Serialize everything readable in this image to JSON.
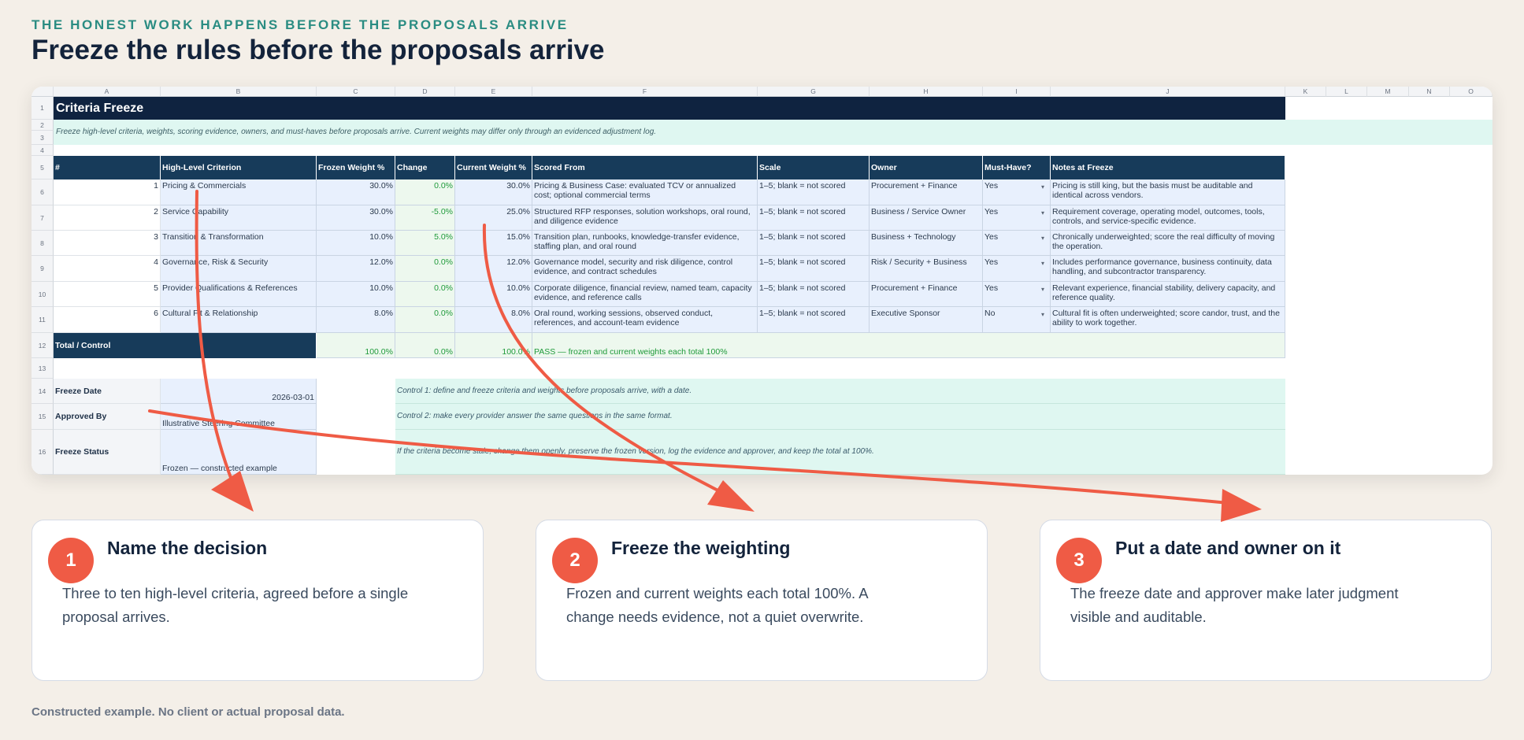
{
  "header": {
    "eyebrow": "THE HONEST WORK HAPPENS BEFORE THE PROPOSALS ARRIVE",
    "title": "Freeze the rules before the proposals arrive"
  },
  "sheet": {
    "columns": [
      "A",
      "B",
      "C",
      "D",
      "E",
      "F",
      "G",
      "H",
      "I",
      "J",
      "K",
      "L",
      "M",
      "N",
      "O"
    ],
    "rows": [
      "1",
      "2",
      "3",
      "4",
      "5",
      "6",
      "7",
      "8",
      "9",
      "10",
      "11",
      "12",
      "13",
      "14",
      "15",
      "16"
    ],
    "title": "Criteria Freeze",
    "intro": "Freeze high-level criteria, weights, scoring evidence, owners, and must-haves before proposals arrive. Current weights may differ only through an evidenced adjustment log.",
    "table_headers": [
      "#",
      "High-Level Criterion",
      "Frozen Weight %",
      "Change",
      "Current Weight %",
      "Scored From",
      "Scale",
      "Owner",
      "Must-Have?",
      "Notes at Freeze"
    ],
    "table_rows": [
      [
        "1",
        "Pricing & Commercials",
        "30.0%",
        "0.0%",
        "30.0%",
        "Pricing & Business Case: evaluated TCV or annualized cost; optional commercial terms",
        "1–5; blank = not scored",
        "Procurement + Finance",
        "Yes",
        "Pricing is still king, but the basis must be auditable and identical across vendors."
      ],
      [
        "2",
        "Service Capability",
        "30.0%",
        "-5.0%",
        "25.0%",
        "Structured RFP responses, solution workshops, oral round, and diligence evidence",
        "1–5; blank = not scored",
        "Business / Service Owner",
        "Yes",
        "Requirement coverage, operating model, outcomes, tools, controls, and service-specific evidence."
      ],
      [
        "3",
        "Transition & Transformation",
        "10.0%",
        "5.0%",
        "15.0%",
        "Transition plan, runbooks, knowledge-transfer evidence, staffing plan, and oral round",
        "1–5; blank = not scored",
        "Business + Technology",
        "Yes",
        "Chronically underweighted; score the real difficulty of moving the operation."
      ],
      [
        "4",
        "Governance, Risk & Security",
        "12.0%",
        "0.0%",
        "12.0%",
        "Governance model, security and risk diligence, control evidence, and contract schedules",
        "1–5; blank = not scored",
        "Risk / Security + Business",
        "Yes",
        "Includes performance governance, business continuity, data handling, and subcontractor transparency."
      ],
      [
        "5",
        "Provider Qualifications & References",
        "10.0%",
        "0.0%",
        "10.0%",
        "Corporate diligence, financial review, named team, capacity evidence, and reference calls",
        "1–5; blank = not scored",
        "Procurement + Finance",
        "Yes",
        "Relevant experience, financial stability, delivery capacity, and reference quality."
      ],
      [
        "6",
        "Cultural Fit & Relationship",
        "8.0%",
        "0.0%",
        "8.0%",
        "Oral round, working sessions, observed conduct, references, and account-team evidence",
        "1–5; blank = not scored",
        "Executive Sponsor",
        "No",
        "Cultural fit is often underweighted; score candor, trust, and the ability to work together."
      ]
    ],
    "total": {
      "label": "Total / Control",
      "frozen": "100.0%",
      "change": "0.0%",
      "current": "100.0%",
      "status": "PASS — frozen and current weights each total 100%"
    },
    "meta": [
      {
        "label": "Freeze Date",
        "value": "2026-03-01",
        "control": "Control 1: define and freeze criteria and weights before proposals arrive, with a date."
      },
      {
        "label": "Approved By",
        "value": "Illustrative Steering Committee",
        "control": "Control 2: make every provider answer the same questions in the same format."
      },
      {
        "label": "Freeze Status",
        "value": "Frozen — constructed example",
        "control": "If the criteria become stale, change them openly, preserve the frozen version, log the evidence and approver, and keep the total at 100%."
      }
    ],
    "dropdown_glyph": "▾"
  },
  "cards": [
    {
      "number": "1",
      "title": "Name the decision",
      "text": "Three to ten high-level criteria, agreed before a single proposal arrives."
    },
    {
      "number": "2",
      "title": "Freeze the weighting",
      "text": "Frozen and current weights each total 100%. A change needs evidence, not a quiet overwrite."
    },
    {
      "number": "3",
      "title": "Put a date and owner on it",
      "text": "The freeze date and approver make later judgment visible and auditable."
    }
  ],
  "footer": "Constructed example. No client or actual proposal data.",
  "colors": {
    "accent": "#ef5b45",
    "header_navy": "#173b5a",
    "title_navy": "#0f2340",
    "teal": "#2a8c82",
    "pass_green": "#1f9a3a"
  }
}
